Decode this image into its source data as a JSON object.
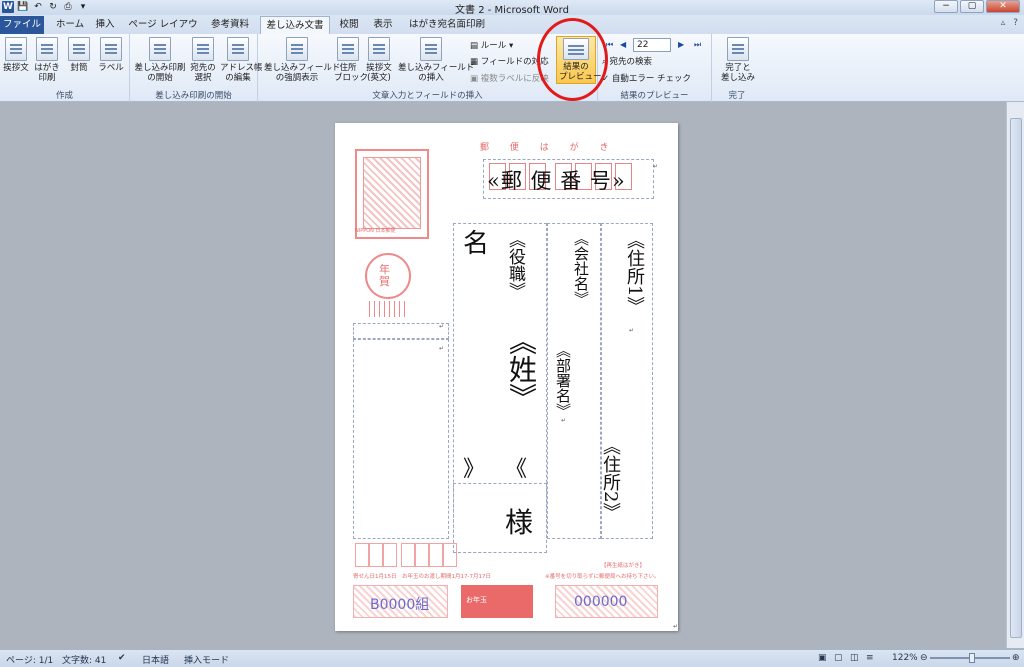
{
  "window": {
    "title": "文書 2 - Microsoft Word",
    "word_logo": "W",
    "controls": [
      "−",
      "▢",
      "✕"
    ]
  },
  "tabs": [
    "ファイル",
    "ホーム",
    "挿入",
    "ページ レイアウト",
    "参考資料",
    "差し込み文書",
    "校閲",
    "表示",
    "はがき宛名面印刷"
  ],
  "active_tab": "差し込み文書",
  "ribbon": {
    "groups": {
      "create": {
        "label": "作成",
        "buttons": [
          "挨拶文",
          "はがき\n印刷",
          "封筒",
          "ラベル"
        ]
      },
      "start_merge": {
        "label": "差し込み印刷の開始",
        "buttons": [
          "差し込み印刷\nの開始",
          "宛先の\n選択",
          "アドレス帳\nの編集"
        ]
      },
      "fields": {
        "label": "文章入力とフィールドの挿入",
        "buttons": [
          "差し込みフィールド\nの強調表示",
          "住所\nブロック",
          "挨拶文\n(英文)",
          "差し込みフィールド\nの挿入"
        ],
        "small": [
          "ルール",
          "フィールドの対応",
          "複数ラベルに反映"
        ]
      },
      "preview": {
        "label": "結果のプレビュー",
        "preview_button": "結果の\nプレビュー",
        "record": "22",
        "small": [
          "宛先の検索",
          "自動エラー チェック"
        ]
      },
      "finish": {
        "label": "完了",
        "button": "完了と\n差し込み"
      }
    }
  },
  "document": {
    "postal_heading": "郵 便 は が き",
    "zip_field": "«郵 便 番 号»",
    "name_label": "名",
    "title_field": "《役職》",
    "company_field": "《会社名》",
    "address1_field": "《住所1》",
    "department_field": "《部署名》",
    "surname_field": "《姓》",
    "left_open": "》",
    "left_open2": "《",
    "address2_field": "《住所2》",
    "honorific": "様",
    "stamp_footer": "NIPPON 日本郵便",
    "nenga_text": "年賀",
    "red_line_left": "寄せん日1月15日　お年玉のお渡し期間1月17-7月17日",
    "red_line_right": "※番号を切り取らずに郵便局へお持ち下さい。",
    "red_top_right": "【再生紙はがき】",
    "lottery_left": "B0000組",
    "lottery_mid": "お年玉",
    "lottery_right": "000000"
  },
  "statusbar": {
    "page": "ページ: 1/1",
    "words": "文字数: 41",
    "language": "日本語",
    "mode": "挿入モード",
    "zoom": "122%"
  },
  "colors": {
    "accent_red": "#e11a1a",
    "tab_file": "#2b579a",
    "postal_pink": "#e76b6b",
    "lottery_blue": "#6b6bcb"
  }
}
